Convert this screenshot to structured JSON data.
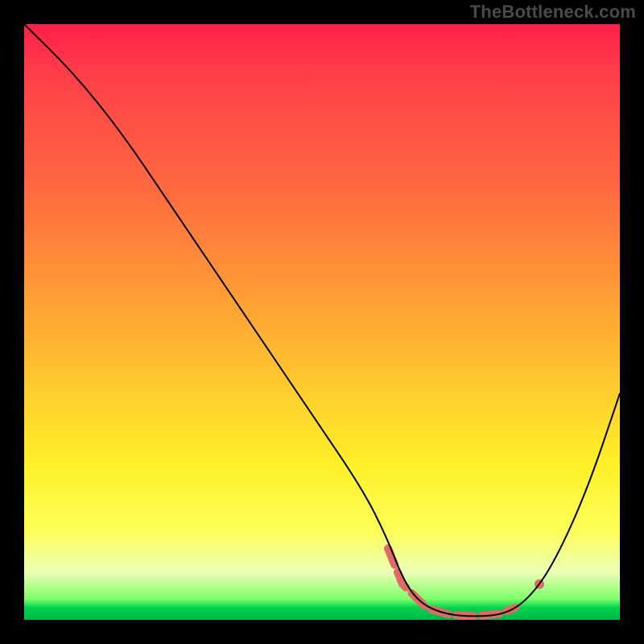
{
  "watermark": "TheBottleneck.com",
  "colors": {
    "black": "#000000",
    "dash": "#e06a66"
  },
  "chart_data": {
    "type": "line",
    "title": "",
    "xlabel": "",
    "ylabel": "",
    "xlim": [
      0,
      740
    ],
    "ylim_percent": [
      0,
      100
    ],
    "grid": false,
    "legend": false,
    "series": [
      {
        "name": "bottleneck-curve",
        "note": "y is relative height 0=bottom 100=top inside plot area",
        "x": [
          0,
          60,
          120,
          180,
          240,
          300,
          360,
          420,
          450,
          470,
          490,
          520,
          560,
          600,
          630,
          660,
          700,
          740
        ],
        "y": [
          100,
          92,
          82,
          70,
          58,
          46,
          34,
          22,
          14,
          7,
          3,
          1,
          0.5,
          1,
          4,
          10,
          22,
          38
        ]
      }
    ],
    "valley": {
      "path": [
        {
          "x": 452,
          "y": 12
        },
        {
          "x": 470,
          "y": 6
        },
        {
          "x": 500,
          "y": 2
        },
        {
          "x": 530,
          "y": 0.8
        },
        {
          "x": 560,
          "y": 0.6
        },
        {
          "x": 590,
          "y": 1.0
        },
        {
          "x": 610,
          "y": 2.0
        }
      ],
      "extra_dot": {
        "x": 640,
        "y": 6
      }
    }
  }
}
